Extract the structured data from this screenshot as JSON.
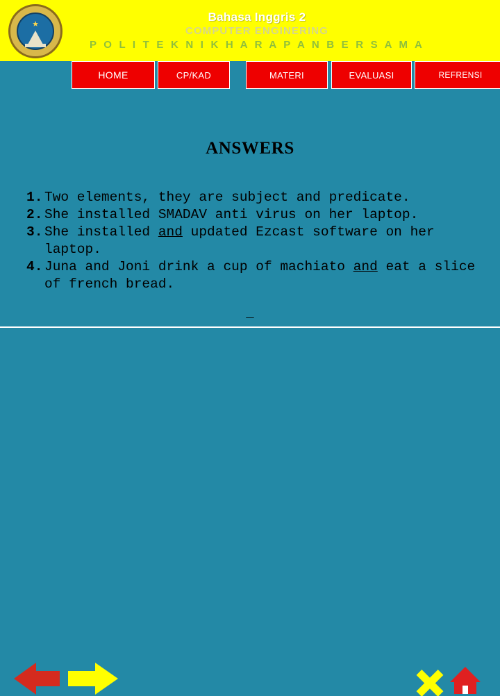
{
  "header": {
    "line1": "Bahasa Inggris 2",
    "line2": "COMPUTER ENGINERING",
    "line3": "P O L I T E K N I K   H A R A P A N   B E R S A M A",
    "logo_alt": "politeknik-logo"
  },
  "nav": {
    "items": [
      {
        "label": "HOME"
      },
      {
        "label": "CP/KAD"
      },
      {
        "label": "MATERI"
      },
      {
        "label": "EVALUASI"
      },
      {
        "label": "REFRENSI"
      }
    ]
  },
  "main": {
    "title": "ANSWERS",
    "answers": [
      {
        "num": "1.",
        "parts": [
          {
            "text": "Two elements, they are subject and predicate.",
            "underline": false
          }
        ]
      },
      {
        "num": "2.",
        "parts": [
          {
            "text": "She installed SMADAV anti virus on her laptop.",
            "underline": false
          }
        ]
      },
      {
        "num": "3.",
        "parts": [
          {
            "text": "She installed ",
            "underline": false
          },
          {
            "text": "and",
            "underline": true
          },
          {
            "text": " updated Ezcast software on her laptop.",
            "underline": false
          }
        ]
      },
      {
        "num": "4.",
        "parts": [
          {
            "text": "Juna and Joni drink a cup of machiato ",
            "underline": false
          },
          {
            "text": "and",
            "underline": true
          },
          {
            "text": " eat a slice of french bread.",
            "underline": false
          }
        ]
      }
    ],
    "separator": "_"
  },
  "footer": {
    "prev_label": "previous-arrow",
    "next_label": "next-arrow",
    "close_label": "close-icon",
    "home_label": "home-icon"
  },
  "colors": {
    "background": "#2389a6",
    "header": "#ffff00",
    "nav_button": "#ee0000",
    "accent_yellow": "#ffff00",
    "accent_red": "#d52b1e"
  }
}
